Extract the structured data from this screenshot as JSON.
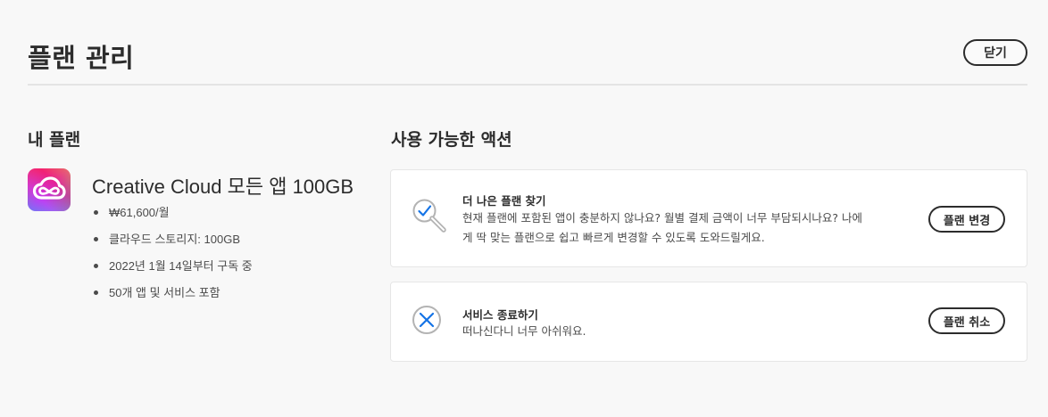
{
  "header": {
    "title": "플랜 관리",
    "close_label": "닫기"
  },
  "my_plan": {
    "heading": "내 플랜",
    "logo_icon": "creative-cloud-logo",
    "plan_name": "Creative Cloud 모든 앱 100GB",
    "details": [
      "₩61,600/월",
      "클라우드 스토리지: 100GB",
      "2022년 1월 14일부터 구독 중",
      "50개 앱 및 서비스 포함"
    ]
  },
  "actions": {
    "heading": "사용 가능한 액션",
    "items": [
      {
        "icon": "magnifier-check-icon",
        "title": "더 나은 플랜 찾기",
        "description_line1": "현재 플랜에 포함된 앱이 충분하지 않나요? 월별 결제 금액이 너무 부담되시나요? 나에",
        "description_line2": "게 딱 맞는 플랜으로 쉽고 빠르게 변경할 수 있도록 도와드릴게요.",
        "button_label": "플랜 변경"
      },
      {
        "icon": "cancel-x-icon",
        "title": "서비스 종료하기",
        "description_line1": "떠나신다니 너무 아쉬워요.",
        "button_label": "플랜 취소"
      }
    ]
  },
  "colors": {
    "background": "#f8f8f8",
    "text": "#2c2c2c",
    "icon_blue": "#1473e6",
    "icon_gray": "#b3b3b3"
  }
}
